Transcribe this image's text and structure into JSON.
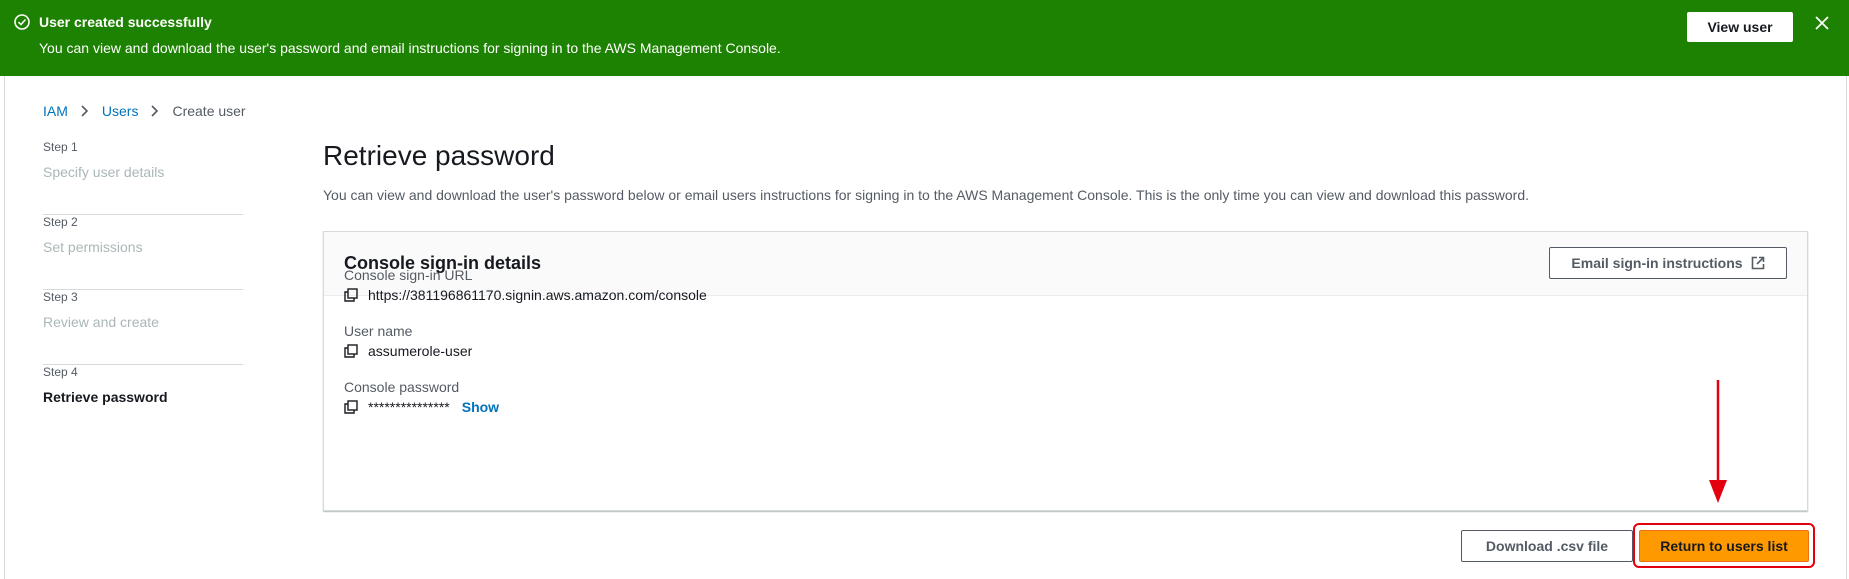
{
  "flash": {
    "title": "User created successfully",
    "message": "You can view and download the user's password and email instructions for signing in to the AWS Management Console.",
    "view_user_label": "View user",
    "color": "#1d8102"
  },
  "breadcrumb": {
    "items": [
      "IAM",
      "Users",
      "Create user"
    ]
  },
  "steps": [
    {
      "number": "Step 1",
      "label": "Specify user details"
    },
    {
      "number": "Step 2",
      "label": "Set permissions"
    },
    {
      "number": "Step 3",
      "label": "Review and create"
    },
    {
      "number": "Step 4",
      "label": "Retrieve password"
    }
  ],
  "page": {
    "title": "Retrieve password",
    "description": "You can view and download the user's password below or email users instructions for signing in to the AWS Management Console. This is the only time you can view and download this password."
  },
  "panel": {
    "title": "Console sign-in details",
    "email_button_label": "Email sign-in instructions",
    "fields": [
      {
        "label": "Console sign-in URL",
        "value": "https://381196861170.signin.aws.amazon.com/console"
      },
      {
        "label": "User name",
        "value": "assumerole-user"
      },
      {
        "label": "Console password",
        "value": "***************",
        "show_label": "Show"
      }
    ]
  },
  "actions": {
    "download_label": "Download .csv file",
    "return_label": "Return to users list",
    "primary_color": "#ff9900"
  },
  "icons": [
    "check-circle-icon",
    "close-icon",
    "chevron-right-icon",
    "external-link-icon",
    "copy-icon"
  ]
}
